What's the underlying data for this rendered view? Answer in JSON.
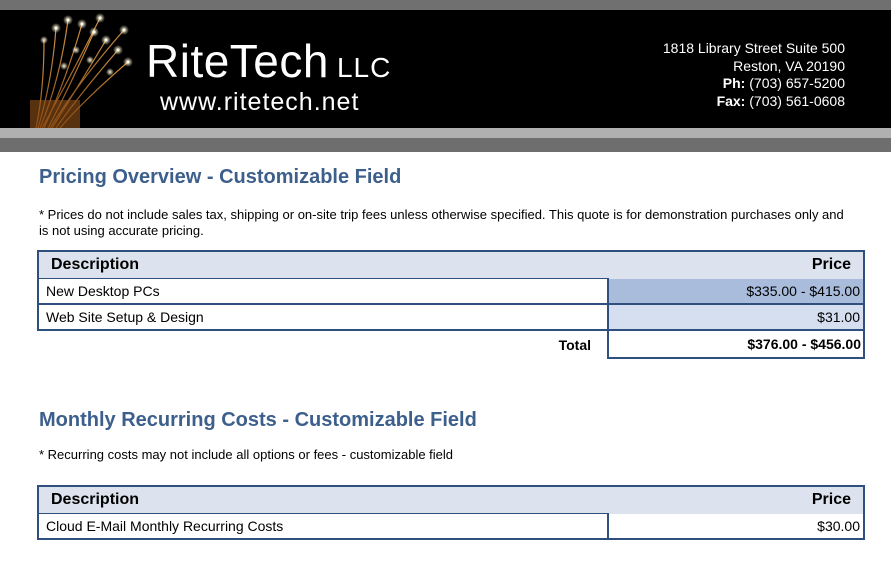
{
  "header": {
    "brand_name": "RiteTech",
    "brand_suffix": "LLC",
    "website": "www.ritetech.net",
    "address_line1": "1818 Library Street Suite 500",
    "address_line2": "Reston, VA 20190",
    "phone_label": "Ph:",
    "phone": "(703) 657-5200",
    "fax_label": "Fax:",
    "fax": "(703) 561-0608"
  },
  "pricing": {
    "title": "Pricing Overview - Customizable Field",
    "note": "* Prices do not include sales tax, shipping or on-site trip fees unless otherwise specified.  This quote is for demonstration purchases only and is not using accurate pricing.",
    "col_description": "Description",
    "col_price": "Price",
    "rows": [
      {
        "description": "New Desktop PCs",
        "price": "$335.00 - $415.00"
      },
      {
        "description": "Web Site Setup & Design",
        "price": "$31.00"
      }
    ],
    "total_label": "Total",
    "total_value": "$376.00 - $456.00"
  },
  "recurring": {
    "title": "Monthly Recurring Costs - Customizable Field",
    "note": "* Recurring costs may not include all options or fees - customizable field",
    "col_description": "Description",
    "col_price": "Price",
    "rows": [
      {
        "description": "Cloud E-Mail Monthly Recurring Costs",
        "price": "$30.00"
      }
    ]
  },
  "colors": {
    "heading": "#3c5f8c",
    "table_border": "#2f4f7f",
    "header_bg": "#dce3ee",
    "price_highlight_1": "#a9bcdc",
    "price_highlight_2": "#d5dff0"
  }
}
